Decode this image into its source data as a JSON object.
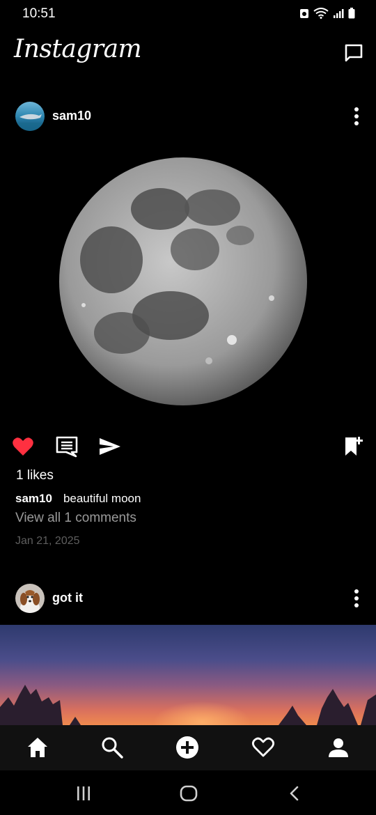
{
  "status_bar": {
    "time": "10:51"
  },
  "header": {
    "logo": "Instagram"
  },
  "posts": [
    {
      "username": "sam10",
      "likes": "1 likes",
      "caption_user": "sam10",
      "caption_text": "beautiful moon",
      "view_comments": "View all 1 comments",
      "date": "Jan 21, 2025",
      "liked": true
    },
    {
      "username": "got it"
    }
  ],
  "bottom_nav": {
    "items": [
      "home-icon",
      "search-icon",
      "add-post-icon",
      "activity-icon",
      "profile-icon"
    ],
    "active": "home-icon"
  },
  "colors": {
    "like_red": "#ff3040",
    "background": "#000000",
    "muted_text": "#9a9a9a"
  }
}
